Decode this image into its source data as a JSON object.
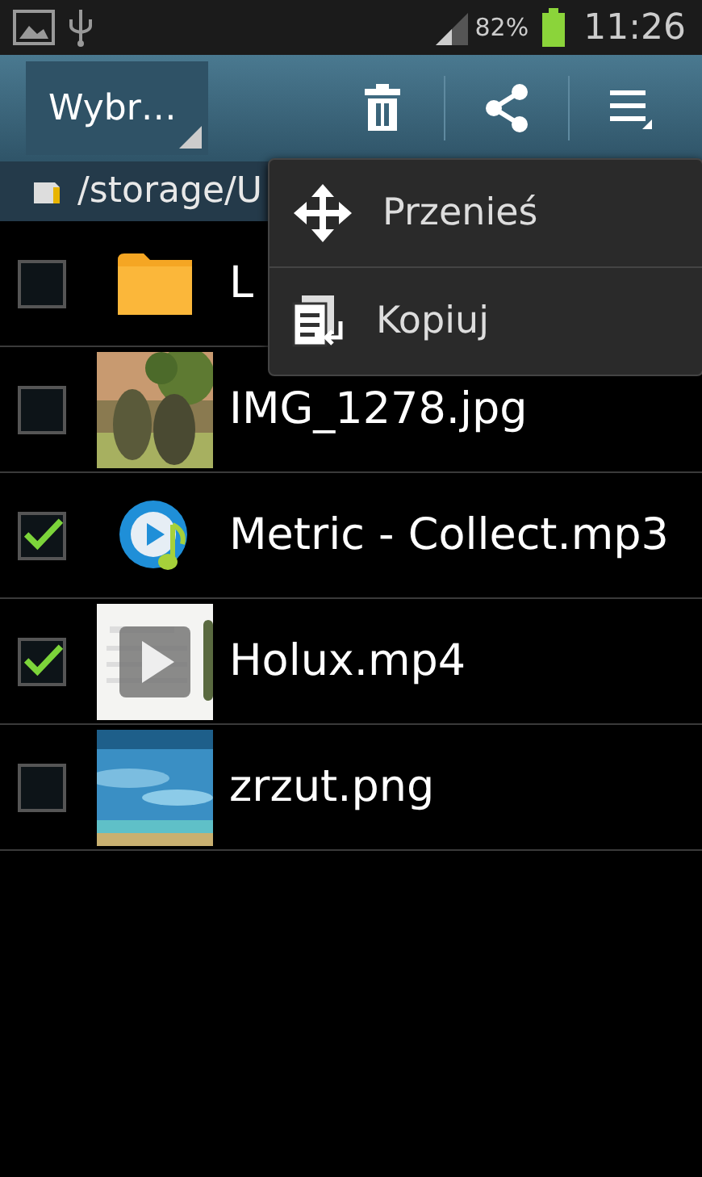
{
  "status_bar": {
    "battery": "82%",
    "time": "11:26"
  },
  "action_bar": {
    "select_label": "Wybr…"
  },
  "path": "/storage/U",
  "files": [
    {
      "name": "L",
      "kind": "folder",
      "checked": false
    },
    {
      "name": "IMG_1278.jpg",
      "checked": false
    },
    {
      "name": "Metric - Collect.mp3",
      "kind": "audio",
      "checked": true
    },
    {
      "name": "Holux.mp4",
      "kind": "video",
      "checked": true
    },
    {
      "name": "zrzut.png",
      "kind": "screenshot",
      "checked": false
    }
  ],
  "menu": [
    {
      "label": "Przenieś",
      "kind": "move"
    },
    {
      "label": "Kopiuj",
      "kind": "copy"
    }
  ]
}
